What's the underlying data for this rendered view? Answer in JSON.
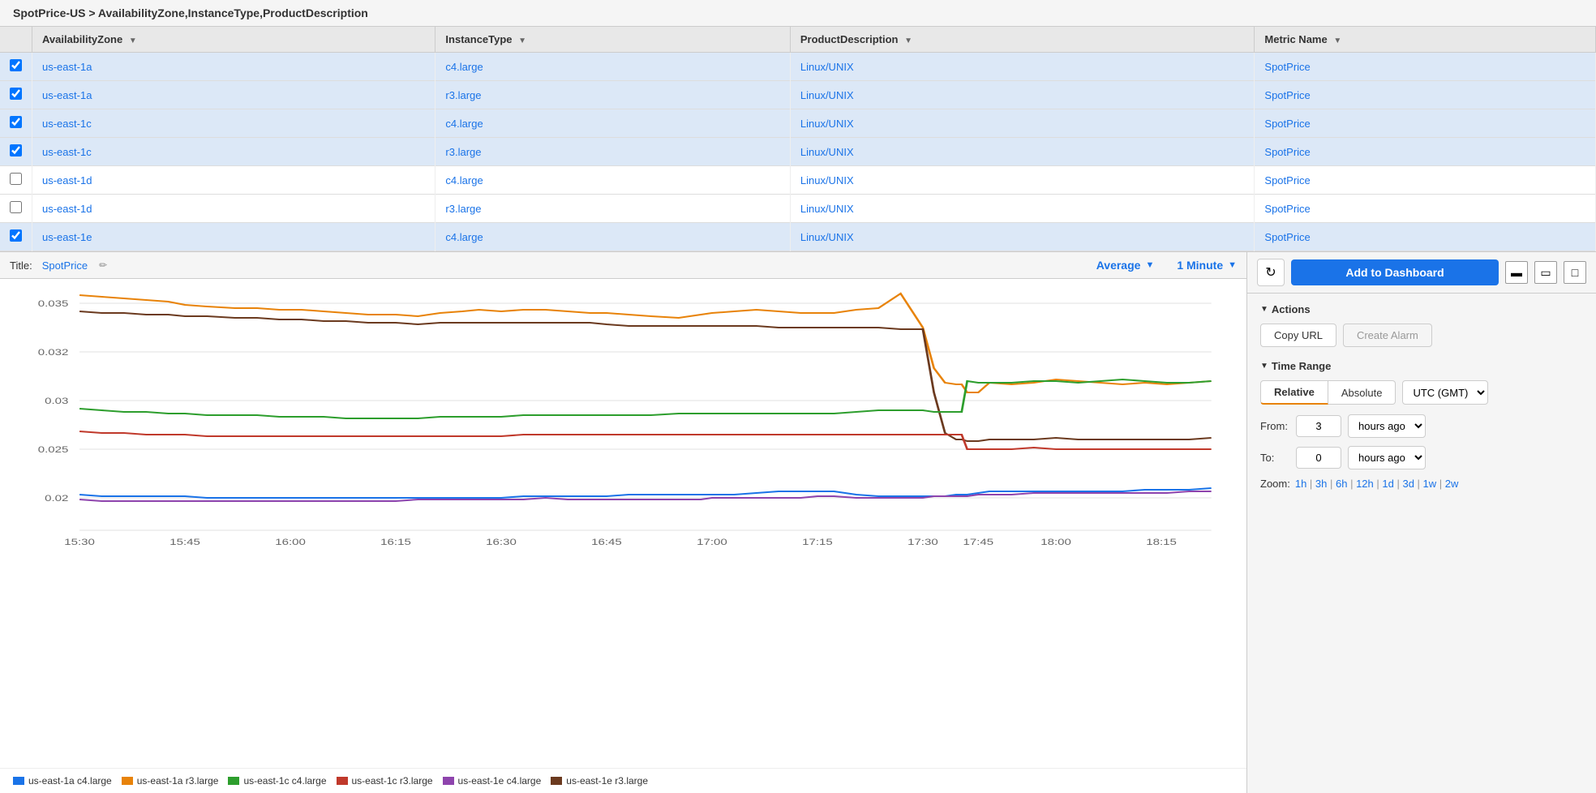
{
  "breadcrumb": {
    "text": "SpotPrice-US > AvailabilityZone,InstanceType,ProductDescription"
  },
  "table": {
    "columns": [
      {
        "id": "az",
        "label": "AvailabilityZone"
      },
      {
        "id": "instanceType",
        "label": "InstanceType"
      },
      {
        "id": "productDesc",
        "label": "ProductDescription"
      },
      {
        "id": "metricName",
        "label": "Metric Name"
      }
    ],
    "rows": [
      {
        "checked": true,
        "az": "us-east-1a",
        "instanceType": "c4.large",
        "productDesc": "Linux/UNIX",
        "metricName": "SpotPrice"
      },
      {
        "checked": true,
        "az": "us-east-1a",
        "instanceType": "r3.large",
        "productDesc": "Linux/UNIX",
        "metricName": "SpotPrice"
      },
      {
        "checked": true,
        "az": "us-east-1c",
        "instanceType": "c4.large",
        "productDesc": "Linux/UNIX",
        "metricName": "SpotPrice"
      },
      {
        "checked": true,
        "az": "us-east-1c",
        "instanceType": "r3.large",
        "productDesc": "Linux/UNIX",
        "metricName": "SpotPrice"
      },
      {
        "checked": false,
        "az": "us-east-1d",
        "instanceType": "c4.large",
        "productDesc": "Linux/UNIX",
        "metricName": "SpotPrice"
      },
      {
        "checked": false,
        "az": "us-east-1d",
        "instanceType": "r3.large",
        "productDesc": "Linux/UNIX",
        "metricName": "SpotPrice"
      },
      {
        "checked": true,
        "az": "us-east-1e",
        "instanceType": "c4.large",
        "productDesc": "Linux/UNIX",
        "metricName": "SpotPrice"
      }
    ]
  },
  "chart": {
    "title_label": "Title:",
    "title_value": "SpotPrice",
    "stat": "Average",
    "period": "1 Minute",
    "y_labels": [
      "0.035",
      "0.03",
      "0.025",
      "0.02"
    ],
    "x_labels": [
      "15:30",
      "15:45",
      "16:00",
      "16:15",
      "16:30",
      "16:45",
      "17:00",
      "17:15",
      "17:30",
      "17:45",
      "18:00",
      "18:15"
    ],
    "legend": [
      {
        "color": "#1a73e8",
        "label": "us-east-1a c4.large"
      },
      {
        "color": "#e8830a",
        "label": "us-east-1a r3.large"
      },
      {
        "color": "#2d9e2d",
        "label": "us-east-1c c4.large"
      },
      {
        "color": "#c0392b",
        "label": "us-east-1c r3.large"
      },
      {
        "color": "#8e44ad",
        "label": "us-east-1e c4.large"
      },
      {
        "color": "#6b3a1f",
        "label": "us-east-1e r3.large"
      }
    ]
  },
  "right_panel": {
    "refresh_icon": "↻",
    "add_dashboard_label": "Add to Dashboard",
    "view_icons": [
      "▬",
      "▭",
      "□"
    ],
    "actions_section": "Actions",
    "copy_url_label": "Copy URL",
    "create_alarm_label": "Create Alarm",
    "time_range_section": "Time Range",
    "tab_relative": "Relative",
    "tab_absolute": "Absolute",
    "timezone": "UTC (GMT)",
    "from_label": "From:",
    "from_value": "3",
    "from_unit": "hours ago",
    "to_label": "To:",
    "to_value": "0",
    "to_unit": "hours ago",
    "zoom_label": "Zoom:",
    "zoom_links": [
      "1h",
      "3h",
      "6h",
      "12h",
      "1d",
      "3d",
      "1w",
      "2w"
    ]
  }
}
